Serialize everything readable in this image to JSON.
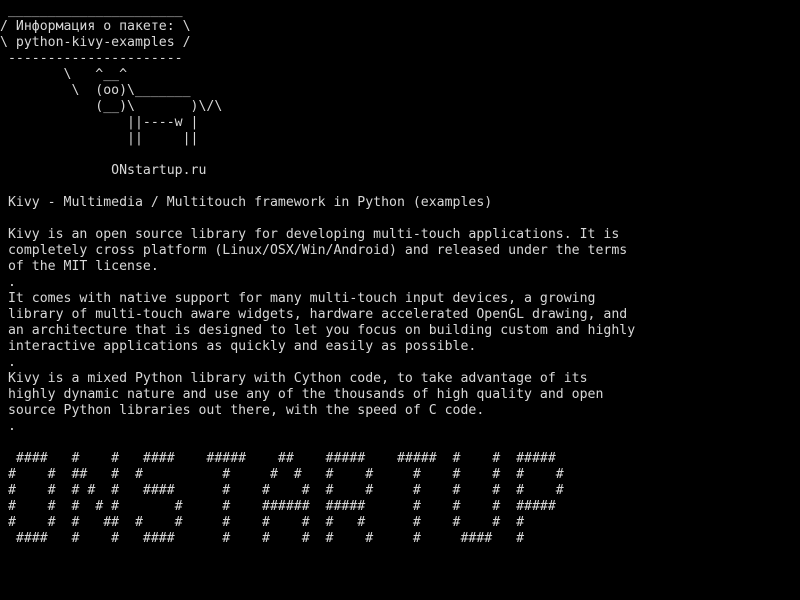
{
  "screen": {
    "foreground": "#d8d8d8",
    "background": "#000000",
    "lines": [
      " ______________________",
      "/ Информация о пакете: \\",
      "\\ python-kivy-examples /",
      " ----------------------",
      "        \\   ^__^",
      "         \\  (oo)\\_______",
      "            (__)\\       )\\/\\",
      "                ||----w |",
      "                ||     ||",
      "",
      "              ONstartup.ru",
      "",
      " Kivy - Multimedia / Multitouch framework in Python (examples)",
      "",
      " Kivy is an open source library for developing multi-touch applications. It is",
      " completely cross platform (Linux/OSX/Win/Android) and released under the terms",
      " of the MIT license.",
      " .",
      " It comes with native support for many multi-touch input devices, a growing",
      " library of multi-touch aware widgets, hardware accelerated OpenGL drawing, and",
      " an architecture that is designed to let you focus on building custom and highly",
      " interactive applications as quickly and easily as possible.",
      " .",
      " Kivy is a mixed Python library with Cython code, to take advantage of its",
      " highly dynamic nature and use any of the thousands of high quality and open",
      " source Python libraries out there, with the speed of C code.",
      " .",
      "",
      "  ####   #    #   ####    #####    ##    #####    #####  #    #  #####",
      " #    #  ##   #  #          #     #  #   #    #     #    #    #  #    #",
      " #    #  # #  #   ####      #    #    #  #    #     #    #    #  #    #",
      " #    #  #  # #       #     #    ######  #####      #    #    #  #####",
      " #    #  #   ##  #    #     #    #    #  #   #      #    #    #  #",
      "  ####   #    #   ####      #    #    #  #    #     #     ####   #"
    ]
  }
}
